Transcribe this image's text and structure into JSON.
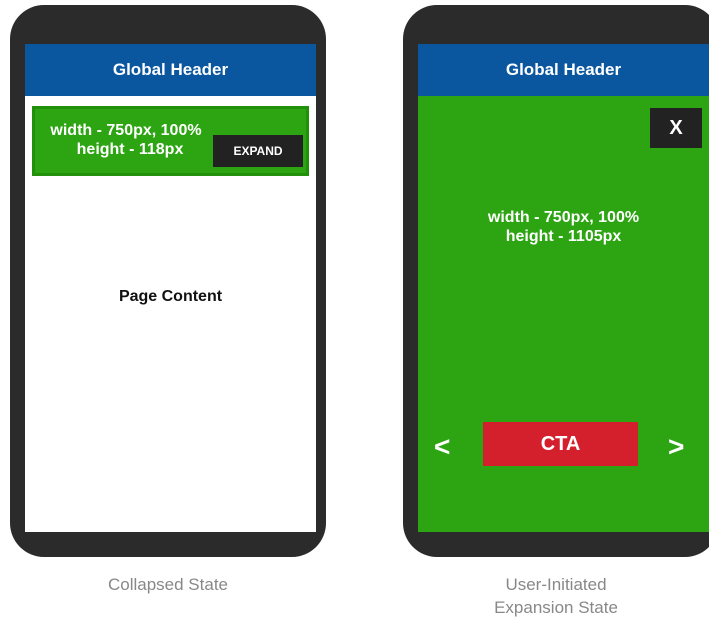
{
  "colors": {
    "phone_frame": "#2b2b2b",
    "header": "#0a57a0",
    "banner_green": "#2da513",
    "button_dark": "#222222",
    "cta_red": "#d4202c",
    "caption_gray": "#888888"
  },
  "collapsed": {
    "header": "Global Header",
    "banner_line1": "width - 750px, 100%",
    "banner_line2": "height - 118px",
    "expand_label": "EXPAND",
    "page_content": "Page Content",
    "caption": "Collapsed State"
  },
  "expanded": {
    "header": "Global Header",
    "close_label": "X",
    "banner_line1": "width - 750px, 100%",
    "banner_line2": "height - 1105px",
    "prev_arrow": "<",
    "cta_label": "CTA",
    "next_arrow": ">",
    "caption_line1": "User-Initiated",
    "caption_line2": "Expansion State"
  }
}
